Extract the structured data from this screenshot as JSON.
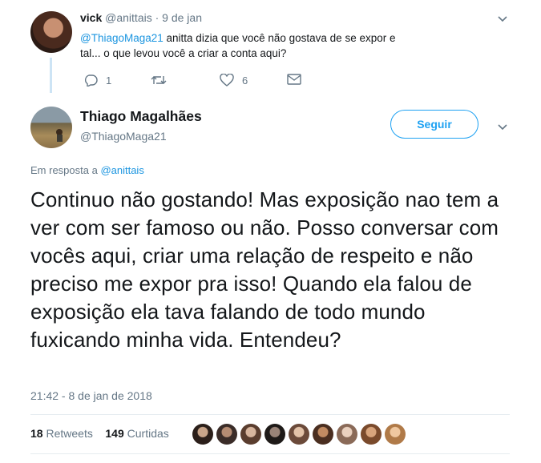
{
  "reply": {
    "name": "vick",
    "handle": "@anittais",
    "separator": "·",
    "date": "9 de jan",
    "mention": "@ThiagoMaga21",
    "text": " anitta dizia que você não gostava de se expor e tal... o que levou você a criar a conta aqui?",
    "replies": "1",
    "likes": "6"
  },
  "tweet": {
    "name": "Thiago Magalhães",
    "handle": "@ThiagoMaga21",
    "follow_label": "Seguir",
    "in_reply_prefix": "Em resposta a ",
    "in_reply_handle": "@anittais",
    "text": "Continuo não gostando! Mas exposição nao tem a ver com ser famoso ou não. Posso conversar com vocês aqui, criar uma relação de respeito e não preciso me expor pra isso! Quando ela falou de exposição ela tava falando de todo mundo fuxicando minha vida. Entendeu?",
    "timestamp": "21:42 - 8 de jan de 2018",
    "retweets_count": "18",
    "retweets_label": "Retweets",
    "likes_count": "149",
    "likes_label": "Curtidas"
  },
  "colors": {
    "accent": "#1da1f2",
    "link": "#1b95e0",
    "muted": "#657786",
    "thread": "#cde4f5"
  },
  "icons": [
    "reply-icon",
    "retweet-icon",
    "heart-icon",
    "message-icon",
    "chevron-down-icon"
  ]
}
